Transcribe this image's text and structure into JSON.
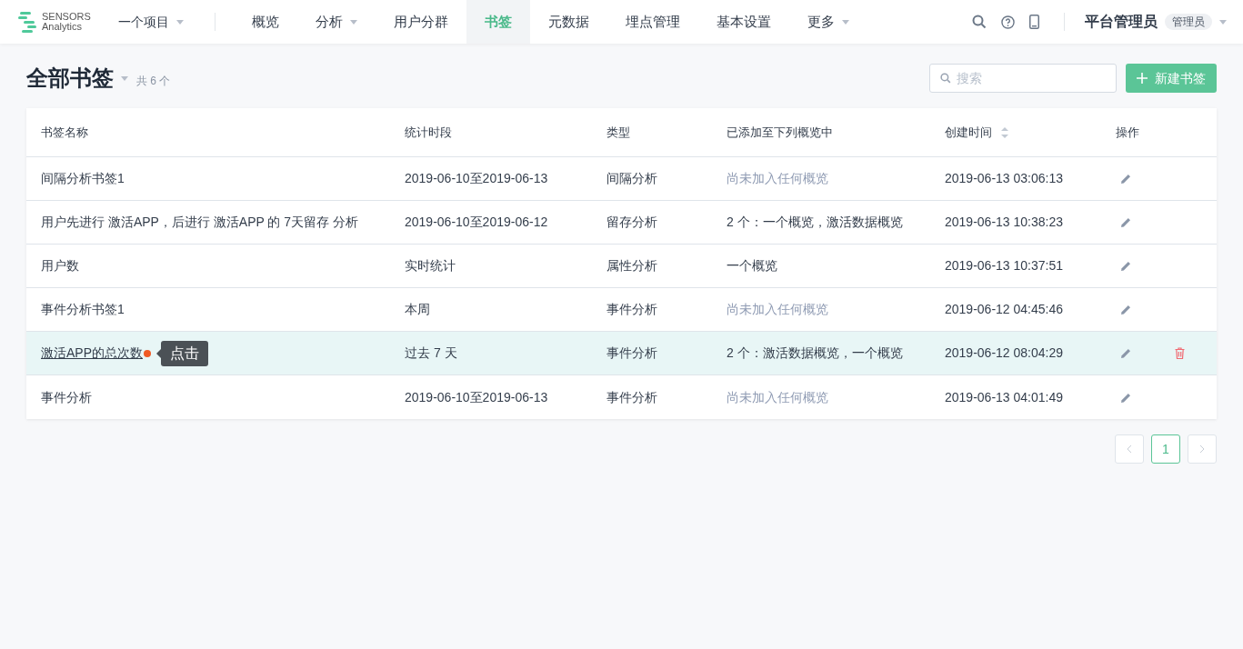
{
  "logo": {
    "line1": "SENSORS",
    "line2": "Analytics"
  },
  "project": {
    "label": "一个项目"
  },
  "nav": [
    {
      "label": "概览",
      "selected": false,
      "dropdown": false
    },
    {
      "label": "分析",
      "selected": false,
      "dropdown": true
    },
    {
      "label": "用户分群",
      "selected": false,
      "dropdown": false
    },
    {
      "label": "书签",
      "selected": true,
      "dropdown": false
    },
    {
      "label": "元数据",
      "selected": false,
      "dropdown": false
    },
    {
      "label": "埋点管理",
      "selected": false,
      "dropdown": false
    },
    {
      "label": "基本设置",
      "selected": false,
      "dropdown": false
    },
    {
      "label": "更多",
      "selected": false,
      "dropdown": true
    }
  ],
  "user": {
    "name": "平台管理员",
    "role": "管理员"
  },
  "page": {
    "title": "全部书签",
    "count": "共 6 个"
  },
  "search": {
    "placeholder": "搜索"
  },
  "new_button": "新建书签",
  "table": {
    "columns": [
      "书签名称",
      "统计时段",
      "类型",
      "已添加至下列概览中",
      "创建时间",
      "操作"
    ],
    "rows": [
      {
        "name": "间隔分析书签1",
        "period": "2019-06-10至2019-06-13",
        "type": "间隔分析",
        "overview": "尚未加入任何概览",
        "overview_empty": true,
        "created": "2019-06-13 03:06:13",
        "hovered": false
      },
      {
        "name": "用户先进行 激活APP，后进行 激活APP 的 7天留存 分析",
        "period": "2019-06-10至2019-06-12",
        "type": "留存分析",
        "overview": "2 个：一个概览，激活数据概览",
        "overview_empty": false,
        "created": "2019-06-13 10:38:23",
        "hovered": false
      },
      {
        "name": "用户数",
        "period": "实时统计",
        "type": "属性分析",
        "overview": "一个概览",
        "overview_empty": false,
        "created": "2019-06-13 10:37:51",
        "hovered": false
      },
      {
        "name": "事件分析书签1",
        "period": "本周",
        "type": "事件分析",
        "overview": "尚未加入任何概览",
        "overview_empty": true,
        "created": "2019-06-12 04:45:46",
        "hovered": false
      },
      {
        "name": "激活APP的总次数",
        "period": "过去 7 天",
        "type": "事件分析",
        "overview": "2 个：激活数据概览，一个概览",
        "overview_empty": false,
        "created": "2019-06-12 08:04:29",
        "hovered": true,
        "tooltip": "点击"
      },
      {
        "name": "事件分析",
        "period": "2019-06-10至2019-06-13",
        "type": "事件分析",
        "overview": "尚未加入任何概览",
        "overview_empty": true,
        "created": "2019-06-13 04:01:49",
        "hovered": false
      }
    ]
  },
  "pagination": {
    "pages": [
      {
        "label": "1",
        "selected": true
      }
    ]
  }
}
